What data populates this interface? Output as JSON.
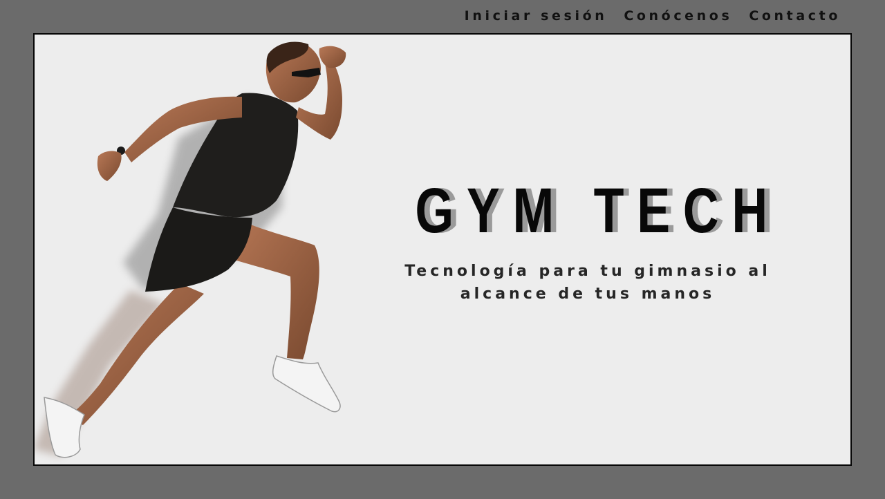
{
  "nav": {
    "login": "Iniciar sesión",
    "about": "Conócenos",
    "contact": "Contacto"
  },
  "hero": {
    "title": "GYM TECH",
    "tagline": "Tecnología para tu gimnasio al alcance de tus manos",
    "image": "sprinter-photo"
  },
  "colors": {
    "page_background": "#6b6b6b",
    "hero_background": "#ededed",
    "title": "#080808",
    "title_shadow": "#9a9a9a"
  }
}
